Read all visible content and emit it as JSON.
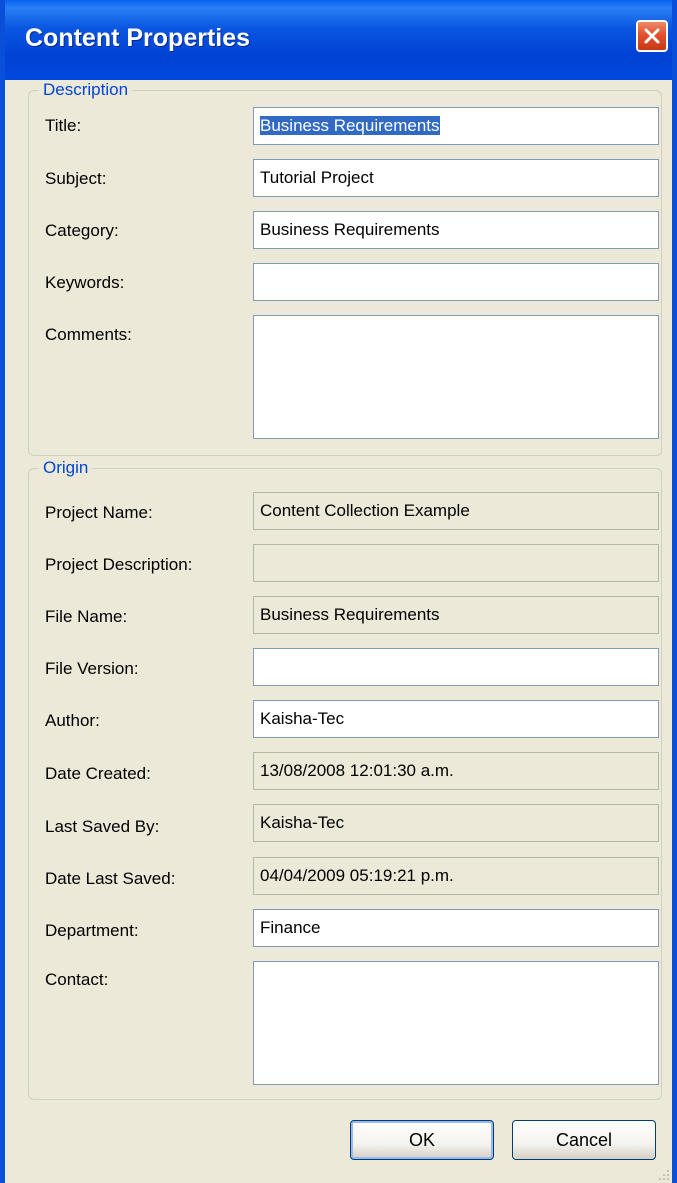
{
  "window": {
    "title": "Content Properties"
  },
  "description": {
    "legend": "Description",
    "title_label": "Title:",
    "title_value": "Business Requirements",
    "subject_label": "Subject:",
    "subject_value": "Tutorial Project",
    "category_label": "Category:",
    "category_value": "Business Requirements",
    "keywords_label": "Keywords:",
    "keywords_value": "",
    "comments_label": "Comments:",
    "comments_value": ""
  },
  "origin": {
    "legend": "Origin",
    "project_name_label": "Project Name:",
    "project_name_value": "Content Collection Example",
    "project_description_label": "Project Description:",
    "project_description_value": "",
    "file_name_label": "File Name:",
    "file_name_value": "Business Requirements",
    "file_version_label": "File Version:",
    "file_version_value": "",
    "author_label": "Author:",
    "author_value": "Kaisha-Tec",
    "date_created_label": "Date Created:",
    "date_created_value": "13/08/2008 12:01:30 a.m.",
    "last_saved_by_label": "Last Saved By:",
    "last_saved_by_value": "Kaisha-Tec",
    "date_last_saved_label": "Date Last Saved:",
    "date_last_saved_value": "04/04/2009 05:19:21 p.m.",
    "department_label": "Department:",
    "department_value": "Finance",
    "contact_label": "Contact:",
    "contact_value": ""
  },
  "buttons": {
    "ok": "OK",
    "cancel": "Cancel"
  },
  "colors": {
    "titlebar": "#0054e3",
    "dialog_background": "#ece9d8",
    "legend_text": "#0046d5",
    "selection": "#316ac5",
    "close_button": "#e2502f"
  },
  "icons": {
    "close": "close-icon",
    "resize": "resize-grip-icon"
  }
}
